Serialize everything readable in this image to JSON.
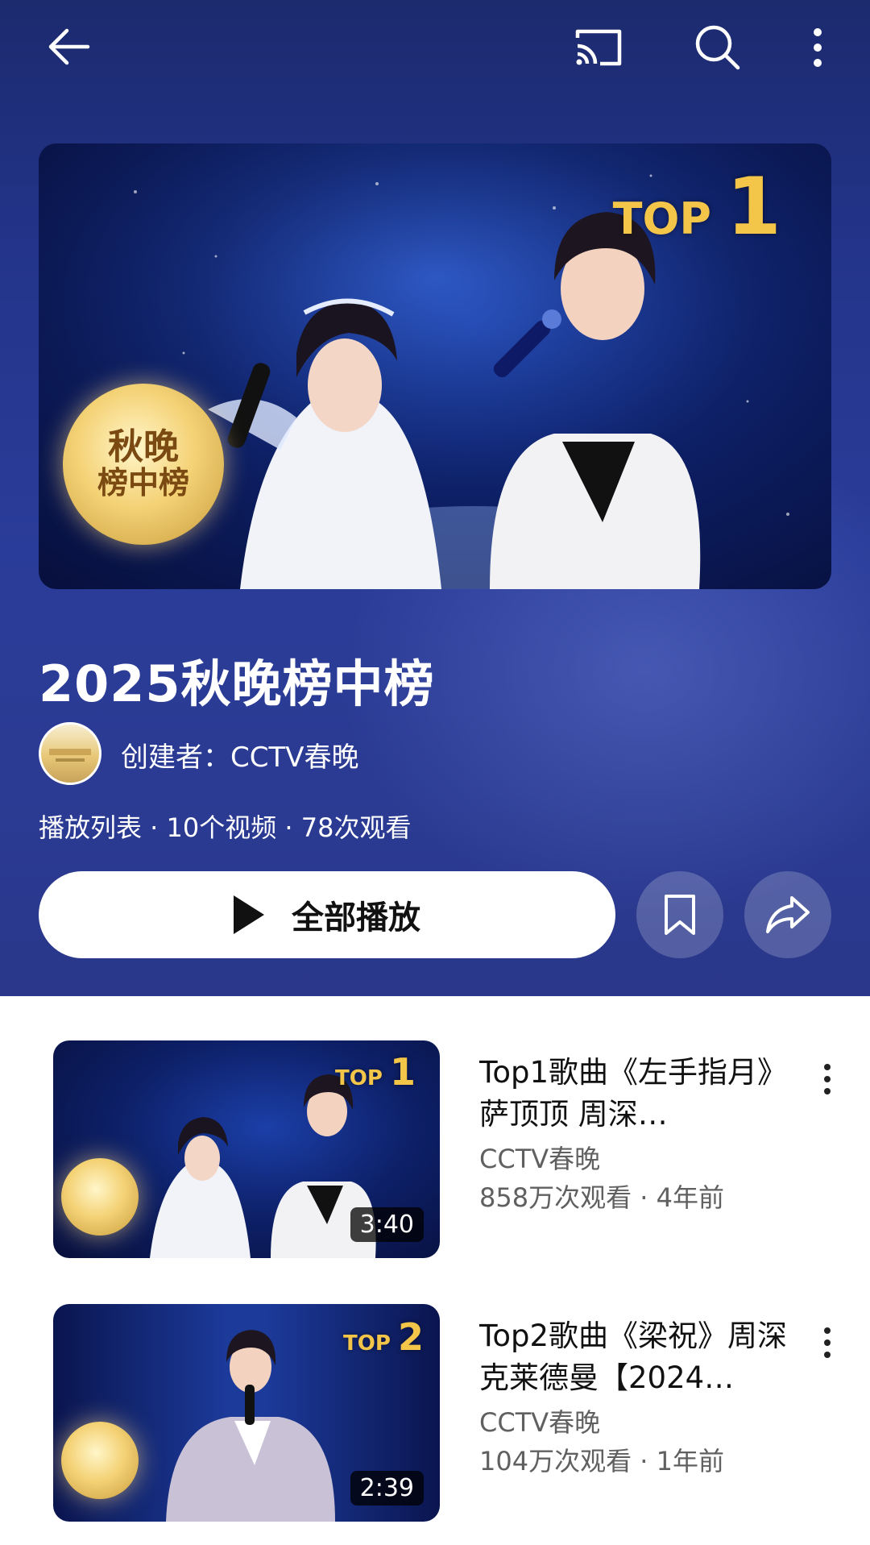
{
  "header": {
    "back_icon": "arrow-left-icon",
    "cast_icon": "cast-icon",
    "search_icon": "search-icon",
    "more_icon": "more-vert-icon"
  },
  "hero": {
    "thumbnail_badge": "TOP",
    "thumbnail_rank": "1",
    "logo_line1": "秋晚",
    "logo_line2": "榜中榜"
  },
  "playlist": {
    "title": "2025秋晚榜中榜",
    "creator": "创建者：CCTV春晚",
    "meta": "播放列表 · 10个视频 · 78次观看",
    "play_all_label": "全部播放",
    "save_icon": "bookmark-icon",
    "share_icon": "share-icon"
  },
  "videos": [
    {
      "badge": "TOP",
      "rank": "1",
      "title": "Top1歌曲《左手指月》萨顶顶 周深…",
      "channel": "CCTV春晚",
      "stats": "858万次观看 · 4年前",
      "duration": "3:40"
    },
    {
      "badge": "TOP",
      "rank": "2",
      "title": "Top2歌曲《梁祝》周深 克莱德曼【2024…",
      "channel": "CCTV春晚",
      "stats": "104万次观看 · 1年前",
      "duration": "2:39"
    }
  ],
  "colors": {
    "hero_bg": "#23348a",
    "badge_gold": "#f3c64a",
    "text_secondary": "#606060"
  }
}
